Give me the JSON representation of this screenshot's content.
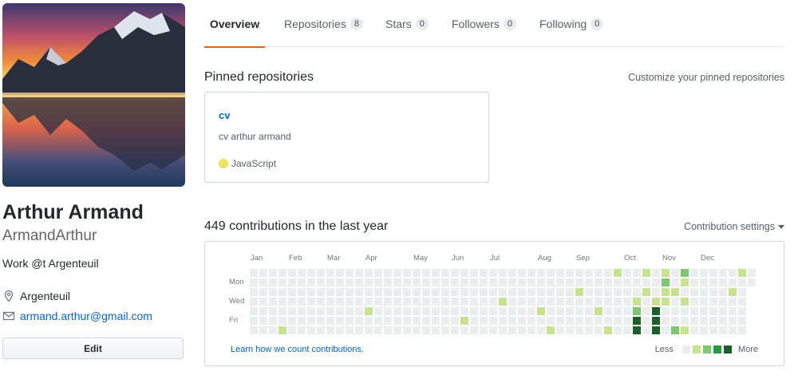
{
  "profile": {
    "full_name": "Arthur Armand",
    "username": "ArmandArthur",
    "bio": "Work @t Argenteuil",
    "location": "Argenteuil",
    "email": "armand.arthur@gmail.com",
    "edit_label": "Edit"
  },
  "tabs": [
    {
      "label": "Overview",
      "count": null
    },
    {
      "label": "Repositories",
      "count": "8"
    },
    {
      "label": "Stars",
      "count": "0"
    },
    {
      "label": "Followers",
      "count": "0"
    },
    {
      "label": "Following",
      "count": "0"
    }
  ],
  "pinned": {
    "title": "Pinned repositories",
    "customize_label": "Customize your pinned repositories",
    "repos": [
      {
        "name": "cv",
        "description": "cv arthur armand",
        "language": "JavaScript",
        "language_color": "#f1e05a"
      }
    ]
  },
  "contributions": {
    "title": "449 contributions in the last year",
    "settings_label": "Contribution settings",
    "months": [
      "Jan",
      "Feb",
      "Mar",
      "Apr",
      "May",
      "Jun",
      "Jul",
      "Aug",
      "Sep",
      "Oct",
      "Nov",
      "Dec"
    ],
    "weekdays": [
      "Mon",
      "Wed",
      "Fri"
    ],
    "learn_label": "Learn how we count contributions.",
    "legend_less": "Less",
    "legend_more": "More",
    "colors": [
      "#ebedf0",
      "#c6e48b",
      "#7bc96f",
      "#239a3b",
      "#196127"
    ],
    "active_cells": [
      [
        3,
        6,
        1
      ],
      [
        12,
        4,
        1
      ],
      [
        22,
        5,
        1
      ],
      [
        26,
        3,
        1
      ],
      [
        30,
        4,
        1
      ],
      [
        31,
        6,
        1
      ],
      [
        34,
        2,
        1
      ],
      [
        36,
        4,
        1
      ],
      [
        37,
        6,
        1
      ],
      [
        38,
        0,
        1
      ],
      [
        40,
        3,
        1
      ],
      [
        40,
        4,
        2
      ],
      [
        40,
        5,
        4
      ],
      [
        40,
        6,
        4
      ],
      [
        41,
        0,
        1
      ],
      [
        41,
        2,
        1
      ],
      [
        42,
        3,
        1
      ],
      [
        42,
        4,
        4
      ],
      [
        42,
        5,
        4
      ],
      [
        42,
        6,
        4
      ],
      [
        43,
        0,
        1
      ],
      [
        43,
        1,
        2
      ],
      [
        43,
        2,
        1
      ],
      [
        43,
        3,
        1
      ],
      [
        44,
        2,
        1
      ],
      [
        44,
        6,
        2
      ],
      [
        45,
        0,
        2
      ],
      [
        45,
        1,
        1
      ],
      [
        45,
        3,
        1
      ],
      [
        45,
        6,
        1
      ],
      [
        50,
        2,
        1
      ],
      [
        51,
        0,
        1
      ]
    ]
  }
}
